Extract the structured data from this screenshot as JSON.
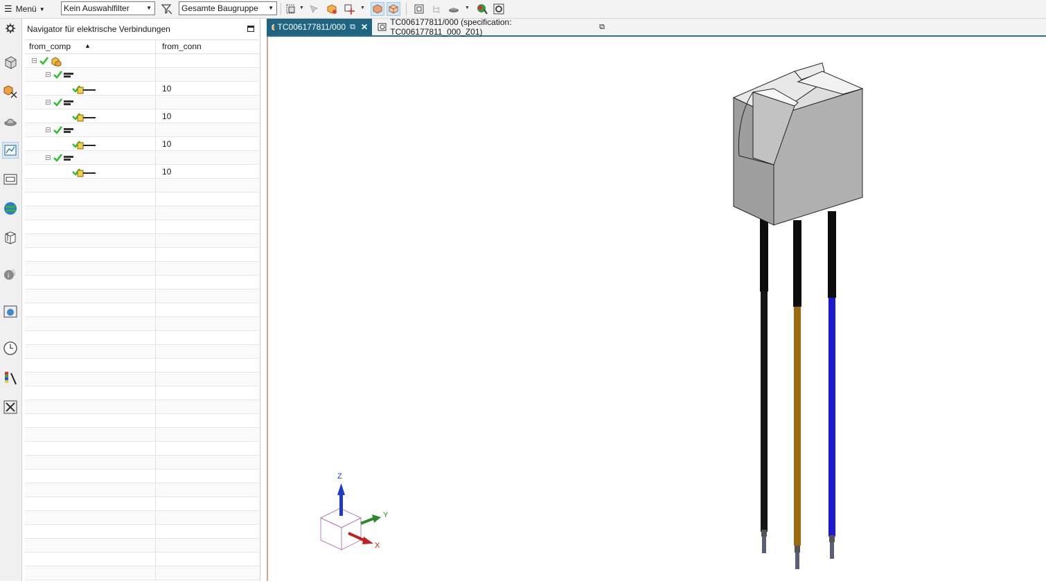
{
  "toolbar": {
    "menu_label": "Menü",
    "selection_filter": "Kein Auswahlfilter",
    "scope_filter": "Gesamte Baugruppe"
  },
  "navigator": {
    "title": "Navigator für elektrische Verbindungen",
    "columns": [
      "from_comp",
      "from_conn"
    ],
    "rows": [
      {
        "level": 0,
        "type": "assembly",
        "from_conn": ""
      },
      {
        "level": 1,
        "type": "connection",
        "from_conn": ""
      },
      {
        "level": 2,
        "type": "wire",
        "from_conn": "10"
      },
      {
        "level": 1,
        "type": "connection",
        "from_conn": ""
      },
      {
        "level": 2,
        "type": "wire",
        "from_conn": "10"
      },
      {
        "level": 1,
        "type": "connection",
        "from_conn": ""
      },
      {
        "level": 2,
        "type": "wire",
        "from_conn": "10"
      },
      {
        "level": 1,
        "type": "connection",
        "from_conn": ""
      },
      {
        "level": 2,
        "type": "wire",
        "from_conn": "10"
      }
    ]
  },
  "tabs": [
    {
      "label": "TC006177811/000",
      "active": true
    },
    {
      "label": "TC006177811/000 (specification: TC006177811_000_Z01)",
      "active": false
    }
  ],
  "triad": {
    "z": "Z",
    "y": "Y",
    "x": "X"
  },
  "colors": {
    "tab_active": "#1f6582",
    "wire_black": "#111111",
    "wire_brown": "#9a6a10",
    "wire_blue": "#1a1ad0",
    "body_gray": "#a8a8a8"
  }
}
